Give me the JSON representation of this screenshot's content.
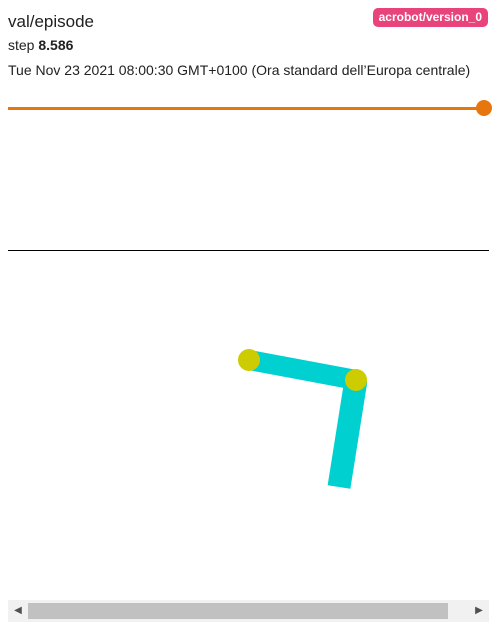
{
  "card": {
    "title": "val/episode",
    "run_name": "acrobot/version_0",
    "run_color": "#e8437a",
    "step_label": "step",
    "step_value": "8.586",
    "timestamp": "Tue Nov 23 2021 08:00:30 GMT+0100 (Ora standard dell’Europa centrale)"
  },
  "slider": {
    "color": "#e8760e",
    "value_fraction": 1.0
  },
  "acrobot": {
    "link_color": "#00d0d0",
    "joint_color": "#cccc00"
  },
  "scrollbar": {
    "left_icon": "triangle-left-icon",
    "right_icon": "triangle-right-icon"
  }
}
